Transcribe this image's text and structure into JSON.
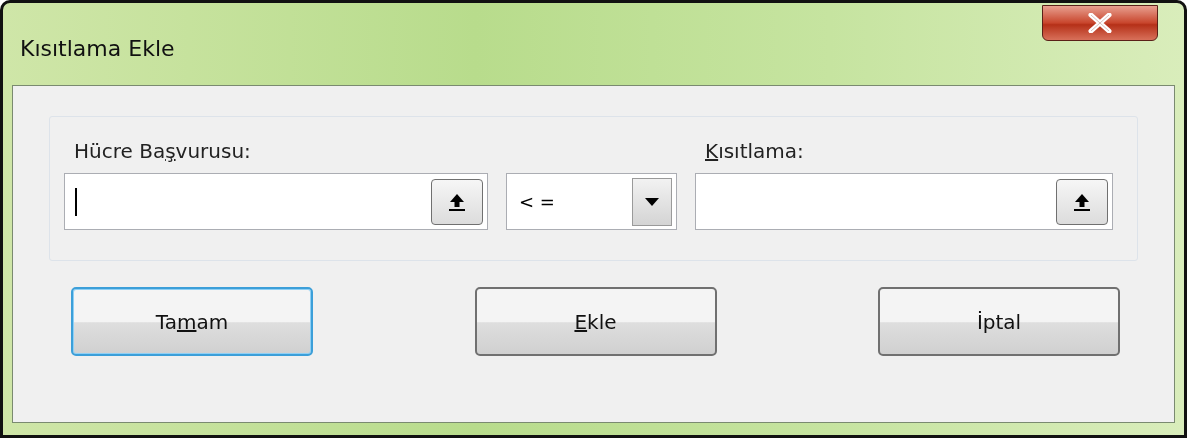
{
  "window": {
    "title": "Kısıtlama Ekle"
  },
  "cell_reference": {
    "label_parts": [
      {
        "text": "Hücre Ba",
        "access_key": false
      },
      {
        "text": "ş",
        "access_key": true
      },
      {
        "text": "vurusu:",
        "access_key": false
      }
    ],
    "focused": true
  },
  "operator": {
    "value": "< ="
  },
  "constraint": {
    "label_parts": [
      {
        "text": "K",
        "access_key": true
      },
      {
        "text": "ısıtlama:",
        "access_key": false
      }
    ],
    "focused": false
  },
  "buttons": [
    {
      "label_parts": [
        {
          "text": "Ta",
          "access_key": false
        },
        {
          "text": "m",
          "access_key": true
        },
        {
          "text": "am",
          "access_key": false
        }
      ],
      "default": true
    },
    {
      "label_parts": [
        {
          "text": "E",
          "access_key": true
        },
        {
          "text": "kle",
          "access_key": false
        }
      ],
      "default": false
    },
    {
      "label_parts": [
        {
          "text": "İptal",
          "access_key": false
        }
      ],
      "default": false
    }
  ]
}
